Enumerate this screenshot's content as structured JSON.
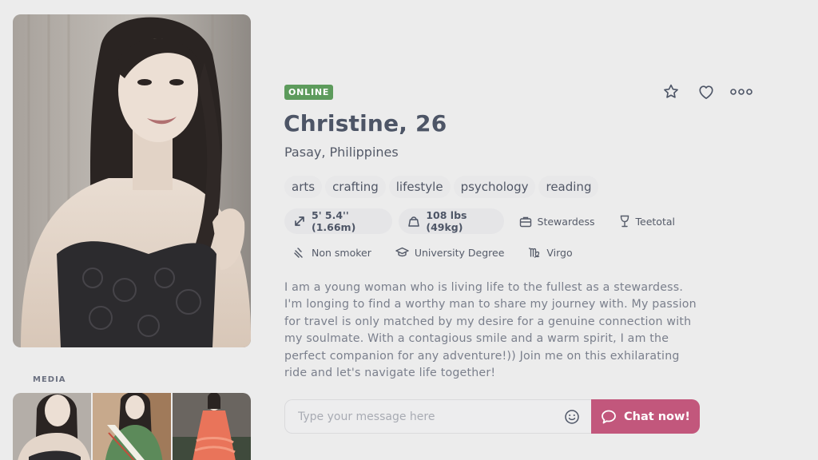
{
  "gallery": {
    "media_label": "MEDIA",
    "thumb_count": 3
  },
  "profile": {
    "status": "ONLINE",
    "name_age": "Christine, 26",
    "location": "Pasay, Philippines",
    "interests": [
      "arts",
      "crafting",
      "lifestyle",
      "psychology",
      "reading"
    ],
    "attributes_row1": [
      {
        "icon": "height-icon",
        "label": "5' 5.4'' (1.66m)",
        "pill": true
      },
      {
        "icon": "weight-icon",
        "label": "108 lbs (49kg)",
        "pill": true
      },
      {
        "icon": "briefcase-icon",
        "label": "Stewardess",
        "pill": false
      },
      {
        "icon": "glass-icon",
        "label": "Teetotal",
        "pill": false
      }
    ],
    "attributes_row2": [
      {
        "icon": "no-smoking-icon",
        "label": "Non smoker",
        "pill": false
      },
      {
        "icon": "graduation-cap-icon",
        "label": "University Degree",
        "pill": false
      },
      {
        "icon": "virgo-icon",
        "label": "Virgo",
        "pill": false
      }
    ],
    "bio": "I am a young woman who is living life to the fullest as a stewardess. I'm longing to find a worthy man to share my journey with. My passion for travel is only matched by my desire for a genuine connection with my soulmate. With a contagious smile and a warm spirit, I am the perfect companion for any adventure!)) Join me on this exhilarating ride and let's navigate life together!"
  },
  "actions": {
    "favorite_icon": "star-icon",
    "like_icon": "heart-icon",
    "more_icon": "more-icon"
  },
  "chat": {
    "placeholder": "Type your message here",
    "send_label": "Chat now!"
  },
  "colors": {
    "status_online": "#5d9b5c",
    "accent": "#c2577c",
    "background": "#ececec"
  }
}
